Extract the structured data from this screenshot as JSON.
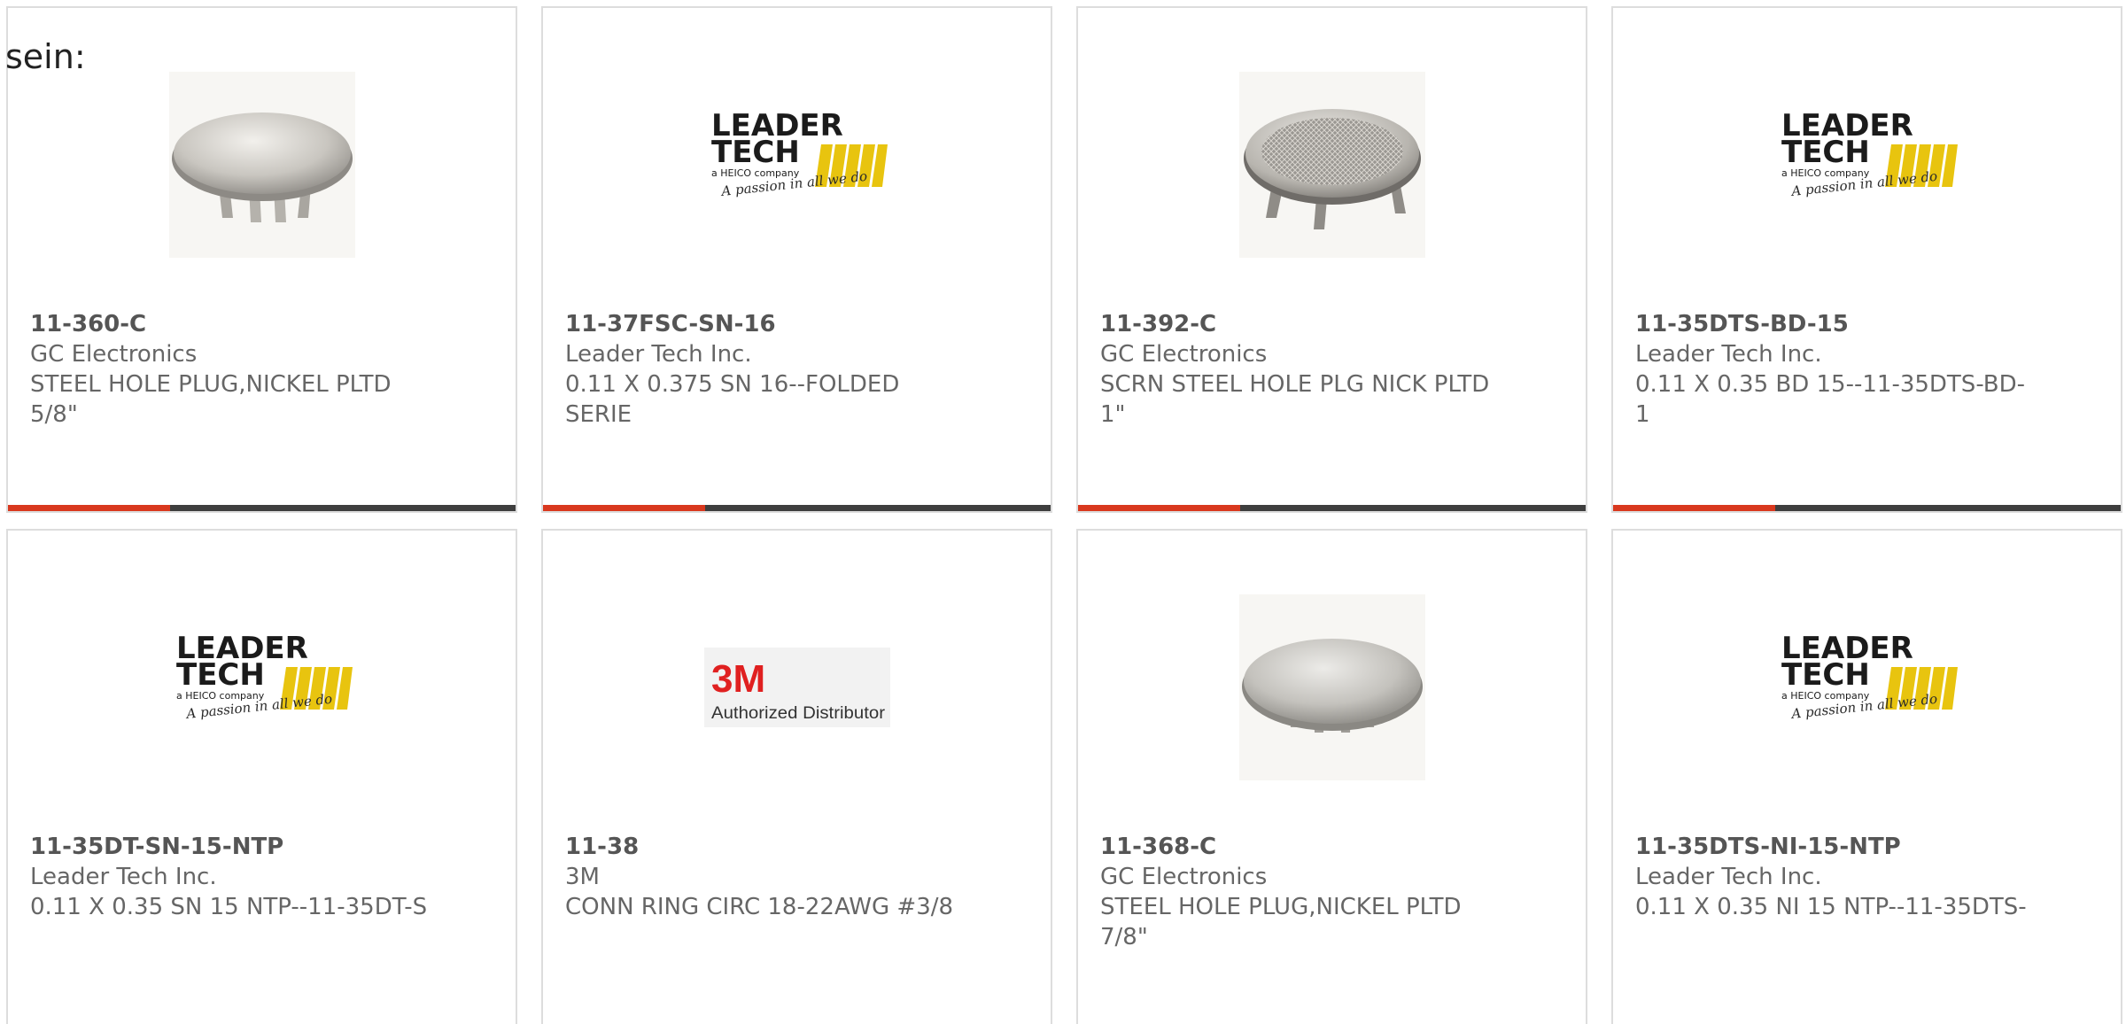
{
  "intro_text": "sein:",
  "colors": {
    "accent": "#d9381e",
    "bar_dark": "#3e3e3e",
    "card_border": "#dddddd",
    "logo_yellow": "#e8c40f",
    "threem_red": "#e02020"
  },
  "logos": {
    "leader_line1": "LEADER",
    "leader_line2": "TECH",
    "leader_tag": "a HEICO company",
    "leader_slogan": "A passion in all we do",
    "threem_mark": "3M",
    "threem_sub": "Authorized Distributor"
  },
  "products": [
    {
      "part_number": "11-360-C",
      "manufacturer": "GC Electronics",
      "description": "STEEL HOLE PLUG,NICKEL PLTD 5/8\"",
      "image": "hole-plug-image"
    },
    {
      "part_number": "11-37FSC-SN-16",
      "manufacturer": "Leader Tech Inc.",
      "description": "0.11 X 0.375 SN 16--FOLDED SERIE",
      "image": "leader-tech-logo"
    },
    {
      "part_number": "11-392-C",
      "manufacturer": "GC Electronics",
      "description": "SCRN STEEL HOLE PLG NICK PLTD 1\"",
      "image": "screen-hole-plug-image"
    },
    {
      "part_number": "11-35DTS-BD-15",
      "manufacturer": "Leader Tech Inc.",
      "description": "0.11 X 0.35 BD 15--11-35DTS-BD-1",
      "image": "leader-tech-logo"
    },
    {
      "part_number": "11-35DT-SN-15-NTP",
      "manufacturer": "Leader Tech Inc.",
      "description": "0.11 X 0.35 SN 15 NTP--11-35DT-S",
      "image": "leader-tech-logo"
    },
    {
      "part_number": "11-38",
      "manufacturer": "3M",
      "description": "CONN RING CIRC 18-22AWG #3/8",
      "image": "3m-logo"
    },
    {
      "part_number": "11-368-C",
      "manufacturer": "GC Electronics",
      "description": "STEEL HOLE PLUG,NICKEL PLTD 7/8\"",
      "image": "hole-plug-image"
    },
    {
      "part_number": "11-35DTS-NI-15-NTP",
      "manufacturer": "Leader Tech Inc.",
      "description": "0.11 X 0.35 NI 15 NTP--11-35DTS-",
      "image": "leader-tech-logo"
    }
  ]
}
